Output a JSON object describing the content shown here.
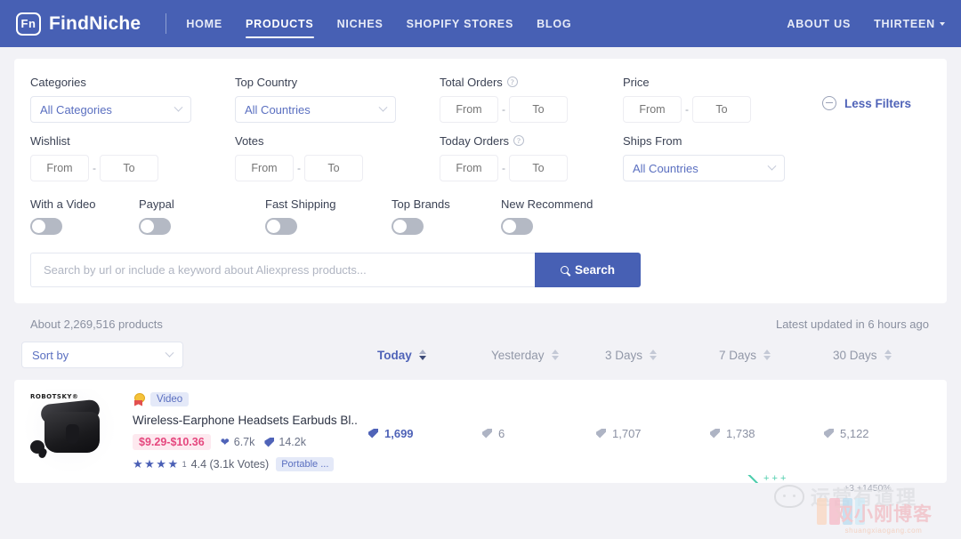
{
  "header": {
    "logo_mark": "Fn",
    "brand": "FindNiche",
    "nav": [
      {
        "label": "HOME",
        "active": false
      },
      {
        "label": "PRODUCTS",
        "active": true
      },
      {
        "label": "NICHES",
        "active": false
      },
      {
        "label": "SHOPIFY STORES",
        "active": false
      },
      {
        "label": "BLOG",
        "active": false
      }
    ],
    "nav_right": [
      {
        "label": "ABOUT US"
      },
      {
        "label": "THIRTEEN"
      }
    ]
  },
  "filters": {
    "categories": {
      "label": "Categories",
      "value": "All Categories"
    },
    "top_country": {
      "label": "Top Country",
      "value": "All Countries"
    },
    "total_orders": {
      "label": "Total Orders",
      "from": "",
      "to": "",
      "from_ph": "From",
      "to_ph": "To",
      "help": "?"
    },
    "price": {
      "label": "Price",
      "from": "",
      "to": "",
      "from_ph": "From",
      "to_ph": "To"
    },
    "wishlist": {
      "label": "Wishlist",
      "from_ph": "From",
      "to_ph": "To"
    },
    "votes": {
      "label": "Votes",
      "from_ph": "From",
      "to_ph": "To"
    },
    "today_orders": {
      "label": "Today Orders",
      "from_ph": "From",
      "to_ph": "To",
      "help": "?"
    },
    "ships_from": {
      "label": "Ships From",
      "value": "All Countries"
    },
    "less_filters": "Less Filters",
    "dash": "-",
    "toggles": [
      {
        "label": "With a Video",
        "on": false
      },
      {
        "label": "Paypal",
        "on": false
      },
      {
        "label": "Fast Shipping",
        "on": false
      },
      {
        "label": "Top Brands",
        "on": false
      },
      {
        "label": "New Recommend",
        "on": false
      }
    ],
    "search": {
      "placeholder": "Search by url or include a keyword about Aliexpress products...",
      "value": "",
      "button": "Search"
    }
  },
  "results": {
    "count_text": "About 2,269,516 products",
    "updated_text": "Latest updated in 6 hours ago",
    "sort_by": "Sort by",
    "periods": [
      {
        "label": "Today",
        "active": true
      },
      {
        "label": "Yesterday",
        "active": false
      },
      {
        "label": "3 Days",
        "active": false
      },
      {
        "label": "7 Days",
        "active": false
      },
      {
        "label": "30 Days",
        "active": false
      }
    ]
  },
  "product": {
    "thumb_brand": "ROBOTSKY®",
    "video_badge": "Video",
    "title": "Wireless-Earphone Headsets Earbuds Bl...",
    "price": "$9.29-$10.36",
    "wishlist": "6.7k",
    "orders": "14.2k",
    "stars": "★★★★",
    "star_partial": "1",
    "rating": "4.4 (3.1k Votes)",
    "tag": "Portable ...",
    "columns": [
      "1,699",
      "6",
      "1,707",
      "1,738",
      "5,122"
    ]
  },
  "watermarks": {
    "trend": "+ + +",
    "trend2": "+3 +1450%",
    "cn_text": "运营有道理",
    "blog_title": "双小刚博客",
    "blog_url": "shuangxiaogang.com"
  },
  "colors": {
    "header_blue": "#4760b4",
    "accent": "#4f63b8",
    "price_pink": "#e5477e",
    "page_bg": "#f2f2f6"
  }
}
